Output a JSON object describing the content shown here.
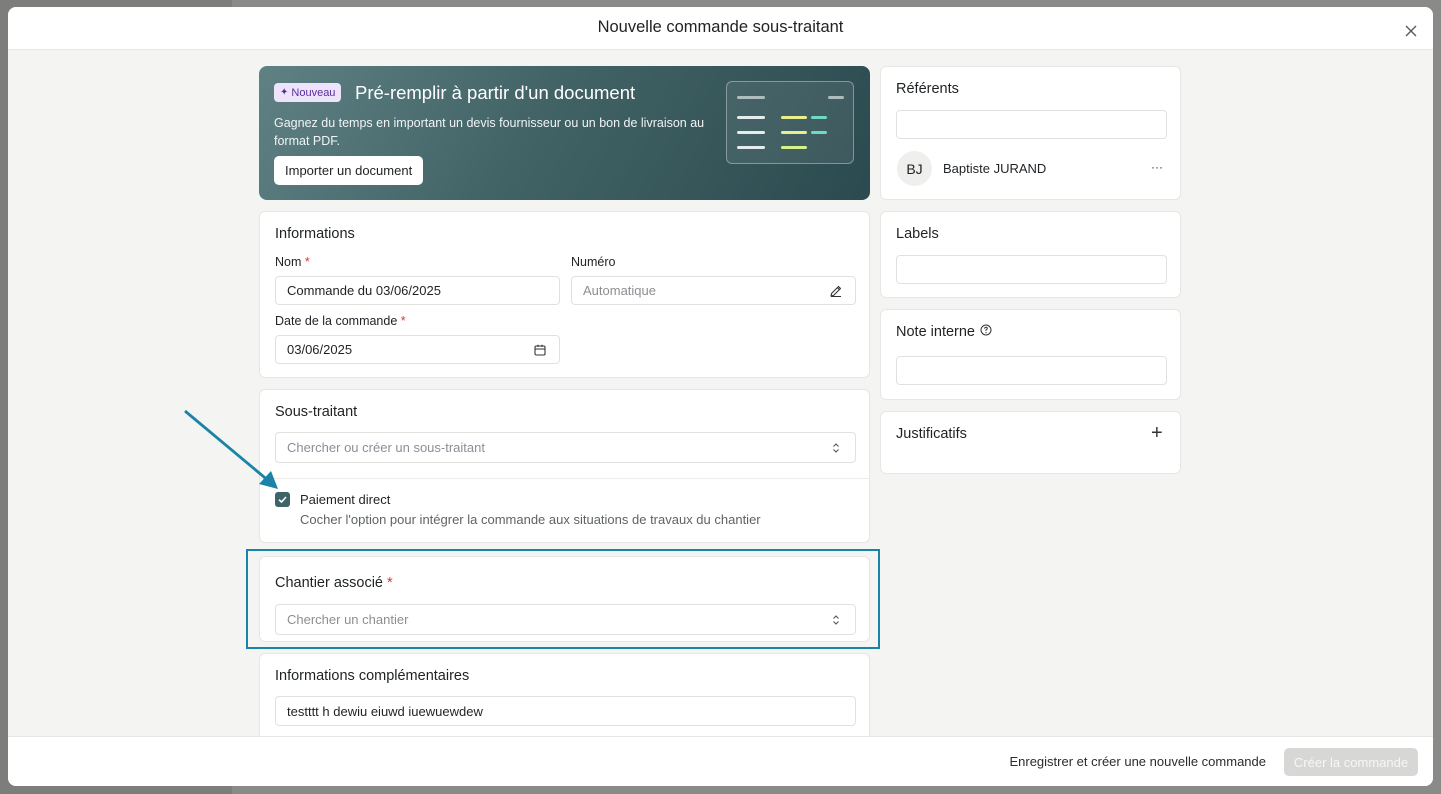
{
  "modal": {
    "title": "Nouvelle commande sous-traitant"
  },
  "banner": {
    "badge": "Nouveau",
    "title": "Pré-remplir à partir d'un document",
    "description": "Gagnez du temps en important un devis fournisseur ou un bon de livraison au format PDF.",
    "button": "Importer un document"
  },
  "informations": {
    "title": "Informations",
    "nom_label": "Nom",
    "nom_value": "Commande du 03/06/2025",
    "numero_label": "Numéro",
    "numero_placeholder": "Automatique",
    "date_label": "Date de la commande",
    "date_value": "03/06/2025",
    "required_mark": "*"
  },
  "sous_traitant": {
    "title": "Sous-traitant",
    "placeholder": "Chercher ou créer un sous-traitant",
    "paiement_label": "Paiement direct",
    "paiement_help": "Cocher l'option pour intégrer la commande aux situations de travaux du chantier",
    "paiement_checked": true
  },
  "chantier": {
    "title": "Chantier associé",
    "placeholder": "Chercher un chantier"
  },
  "complementaires": {
    "title": "Informations complémentaires",
    "value": "testttt h dewiu eiuwd iuewuewdew"
  },
  "referents": {
    "title": "Référents",
    "user_initials": "BJ",
    "user_name": "Baptiste JURAND",
    "more": "···"
  },
  "labels": {
    "title": "Labels"
  },
  "note": {
    "title": "Note interne"
  },
  "justificatifs": {
    "title": "Justificatifs",
    "add": "+"
  },
  "footer": {
    "secondary": "Enregistrer et créer une nouvelle commande",
    "primary": "Créer la commande"
  },
  "colors": {
    "accent": "#3e6469",
    "highlight": "#1a83a7",
    "required": "#d9363e"
  }
}
